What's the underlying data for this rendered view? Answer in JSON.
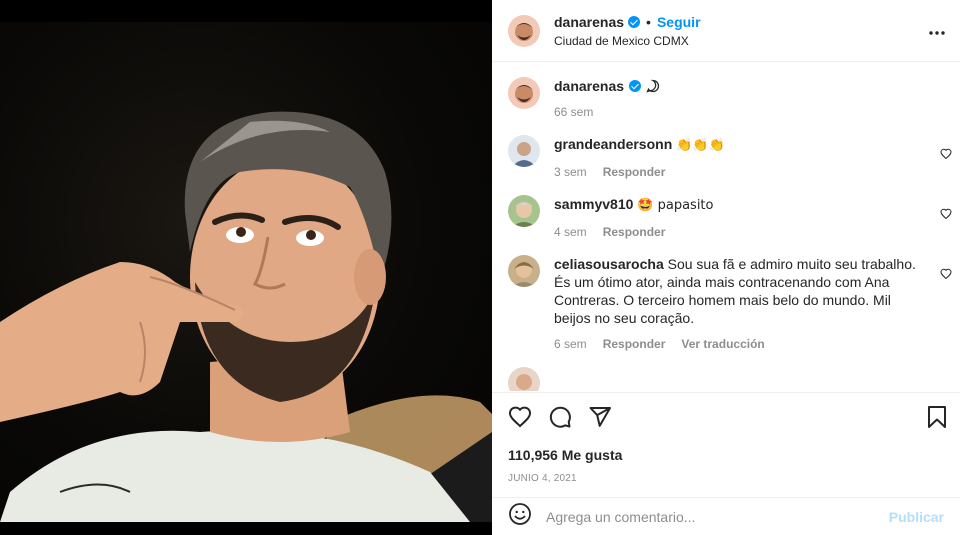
{
  "header": {
    "username": "danarenas",
    "separator": "•",
    "follow_label": "Seguir",
    "location": "Ciudad de Mexico CDMX",
    "more_icon": "more-horizontal-icon"
  },
  "caption": {
    "username": "danarenas",
    "age": "66 sem",
    "icon": "speech-bubble-icon"
  },
  "comments": [
    {
      "username": "grandeandersonn",
      "text": "👏👏👏",
      "age": "3 sem",
      "reply": "Responder"
    },
    {
      "username": "sammyv810",
      "text": "🤩 papasito",
      "age": "4 sem",
      "reply": "Responder"
    },
    {
      "username": "celiasousarocha",
      "text": "Sou sua fã e admiro muito seu trabalho. És um ótimo ator, ainda mais contracenando com Ana Contreras. O terceiro homem mais belo do mundo. Mil beijos no seu coração.",
      "age": "6 sem",
      "reply": "Responder",
      "translate": "Ver traducción"
    }
  ],
  "actions": {
    "likes": "110,956 Me gusta",
    "date": "JUNIO 4, 2021"
  },
  "add_comment": {
    "placeholder": "Agrega un comentario...",
    "publish_label": "Publicar"
  },
  "colors": {
    "accent": "#0095f6",
    "publish_disabled": "#b2dffc",
    "muted": "#8e8e8e"
  }
}
